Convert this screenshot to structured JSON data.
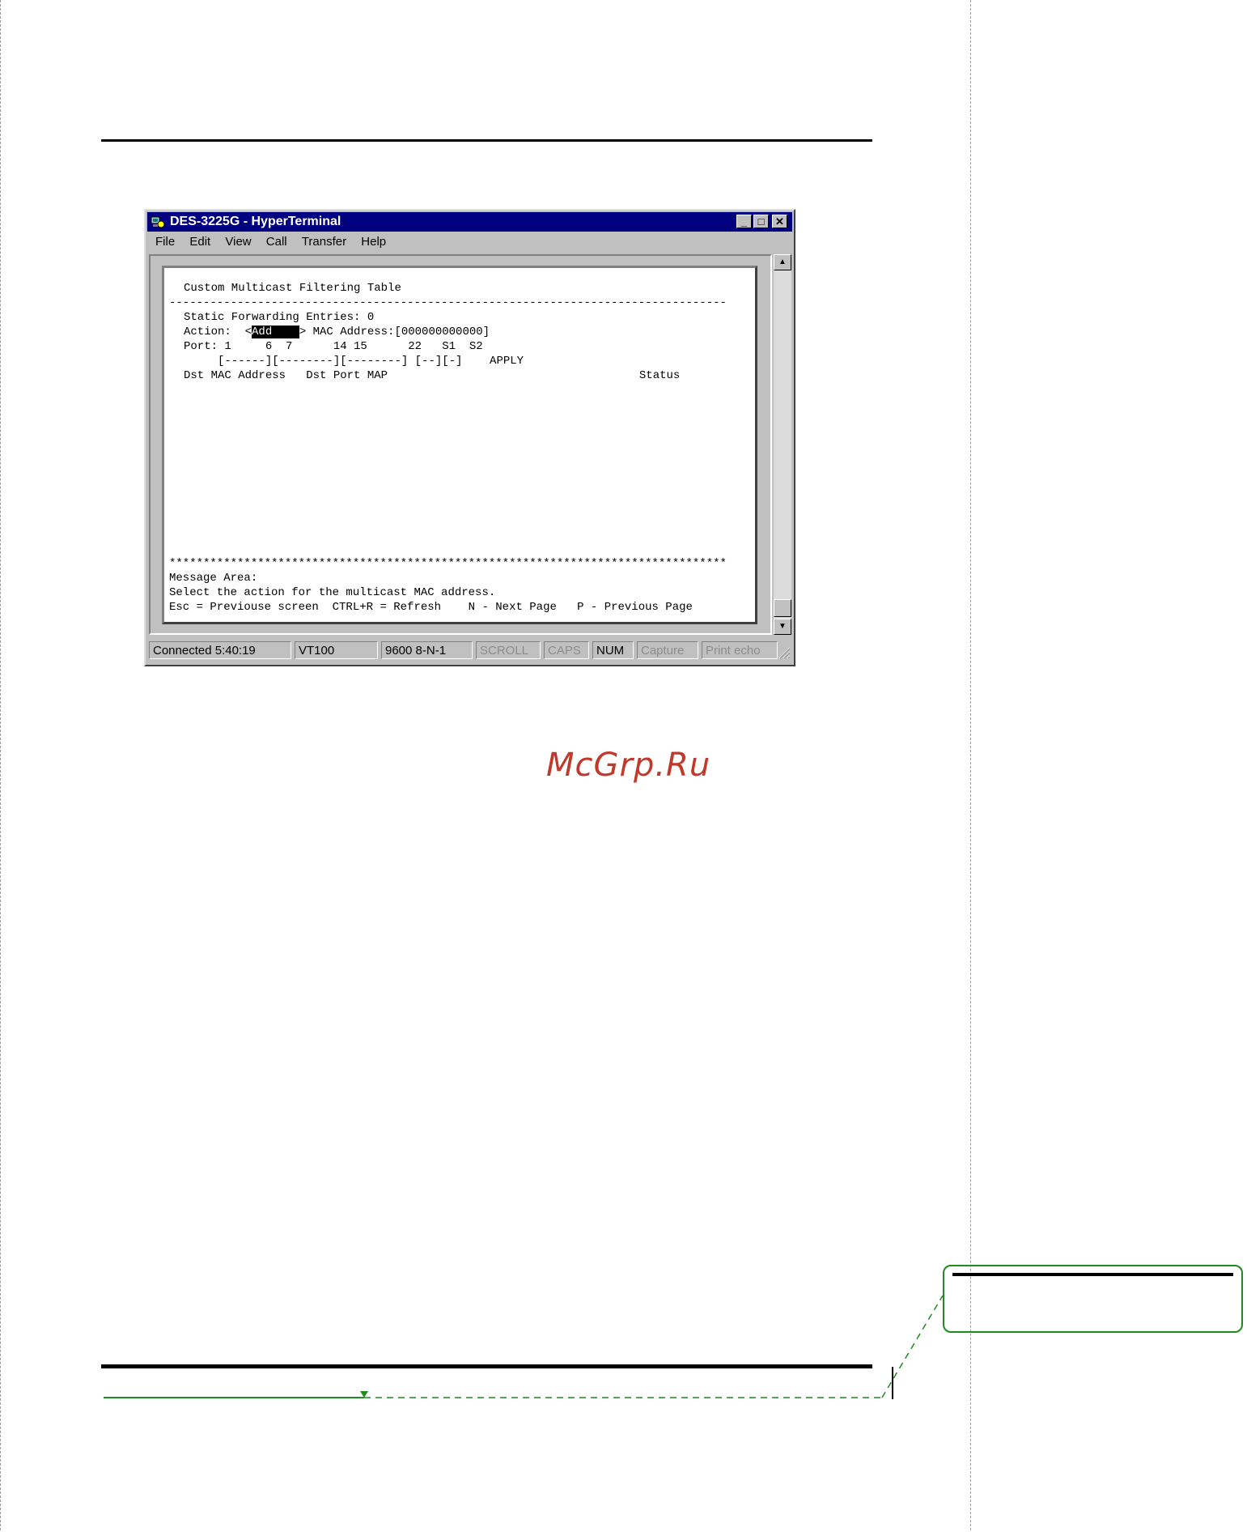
{
  "window": {
    "title": "DES-3225G - HyperTerminal",
    "buttons": {
      "minimize": "_",
      "maximize": "□",
      "close": "✕"
    },
    "menu": [
      "File",
      "Edit",
      "View",
      "Call",
      "Transfer",
      "Help"
    ]
  },
  "terminal": {
    "title": "Custom Multicast Filtering Table",
    "separator": "----------------------------------------------------------------------------------",
    "entries_line": "Static Forwarding Entries: 0",
    "action_label": "Action:  <",
    "action_value": "Add    ",
    "action_suffix": "> MAC Address:[000000000000]",
    "port_line": "Port: 1     6  7      14 15      22   S1  S2",
    "port_map_line": "     [------][--------][--------] [--][-]    APPLY",
    "header_line": "Dst MAC Address   Dst Port MAP                                     Status",
    "stars": "**********************************************************************************",
    "message_area_label": "Message Area:",
    "message": "Select the action for the multicast MAC address.",
    "help_line": "Esc = Previouse screen  CTRL+R = Refresh    N - Next Page   P - Previous Page"
  },
  "statusbar": {
    "connected": "Connected 5:40:19",
    "emulation": "VT100",
    "settings": "9600 8-N-1",
    "scroll": "SCROLL",
    "caps": "CAPS",
    "num": "NUM",
    "capture": "Capture",
    "print_echo": "Print echo"
  },
  "watermark": "McGrp.Ru"
}
